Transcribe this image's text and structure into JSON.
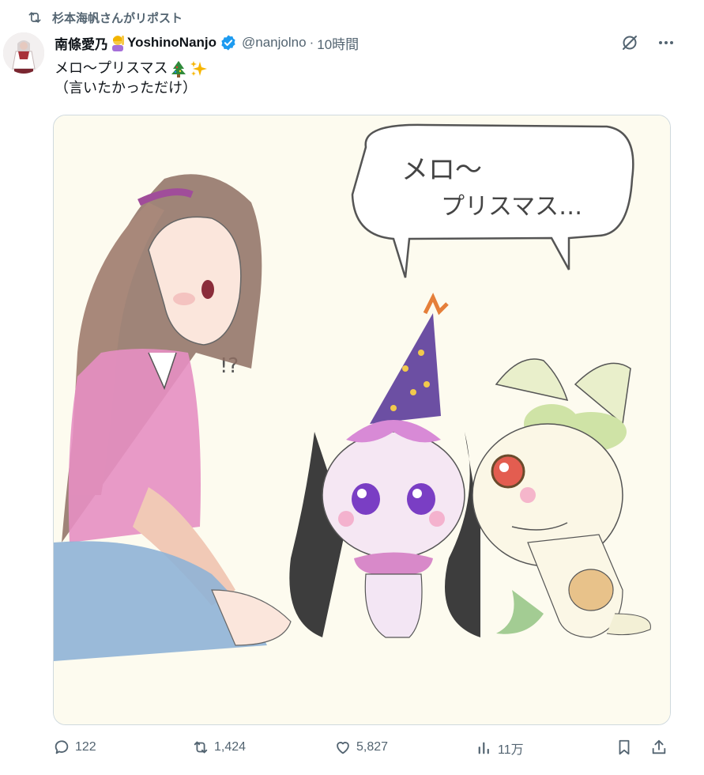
{
  "repost": {
    "icon": "repost-icon",
    "text": "杉本海帆さんがリポスト"
  },
  "author": {
    "name": "南條愛乃",
    "name_suffix": "YoshinoNanjo",
    "emoji": "person-raising-hand-emoji",
    "verified_icon": "verified-badge-icon",
    "handle": "@nanjolno",
    "separator": "·",
    "time": "10時間"
  },
  "tweet": {
    "line1": "メロ〜プリスマス",
    "line1_emojis": [
      "christmas-tree-emoji",
      "sparkles-emoji"
    ],
    "line2": "（言いたかっただけ）"
  },
  "media": {
    "speech_line1": "メロ〜",
    "speech_line2": "プリスマス…",
    "aside": "!?"
  },
  "actions": {
    "reply": {
      "icon": "reply-icon",
      "count": "122"
    },
    "repost": {
      "icon": "repost-icon",
      "count": "1,424"
    },
    "like": {
      "icon": "heart-icon",
      "count": "5,827"
    },
    "views": {
      "icon": "views-icon",
      "count": "11万"
    },
    "bookmark": {
      "icon": "bookmark-icon"
    },
    "share": {
      "icon": "share-icon"
    }
  },
  "colors": {
    "secondary_text": "#536471",
    "verified": "#1d9bf0",
    "border": "#cfd9de"
  }
}
